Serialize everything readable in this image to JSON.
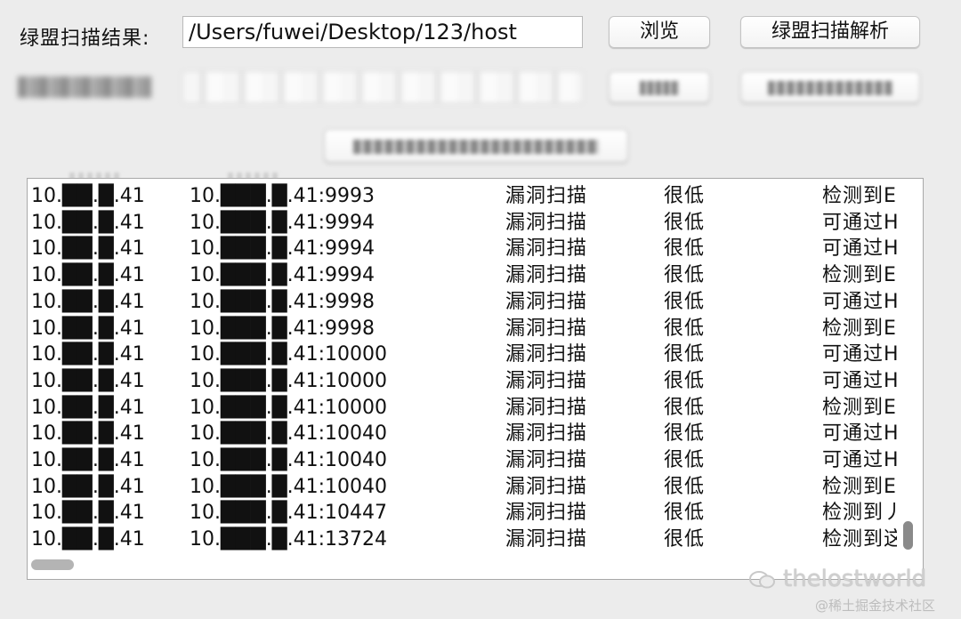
{
  "form": {
    "result_label": "绿盟扫描结果:",
    "path_value": "/Users/fuwei/Desktop/123/host",
    "browse_label": "浏览",
    "parse_label": "绿盟扫描解析"
  },
  "table": {
    "rows": [
      {
        "src": "10.██.█.41",
        "dst": "10.███.█.41:9993",
        "type": "漏洞扫描",
        "level": "很低",
        "desc": "检测到E"
      },
      {
        "src": "10.██.█.41",
        "dst": "10.███.█.41:9994",
        "type": "漏洞扫描",
        "level": "很低",
        "desc": "可通过H"
      },
      {
        "src": "10.██.█.41",
        "dst": "10.███.█.41:9994",
        "type": "漏洞扫描",
        "level": "很低",
        "desc": "可通过H"
      },
      {
        "src": "10.██.█.41",
        "dst": "10.███.█.41:9994",
        "type": "漏洞扫描",
        "level": "很低",
        "desc": "检测到E"
      },
      {
        "src": "10.██.█.41",
        "dst": "10.███.█.41:9998",
        "type": "漏洞扫描",
        "level": "很低",
        "desc": "可通过H"
      },
      {
        "src": "10.██.█.41",
        "dst": "10.███.█.41:9998",
        "type": "漏洞扫描",
        "level": "很低",
        "desc": "检测到E"
      },
      {
        "src": "10.██.█.41",
        "dst": "10.███.█.41:10000",
        "type": "漏洞扫描",
        "level": "很低",
        "desc": "可通过H"
      },
      {
        "src": "10.██.█.41",
        "dst": "10.███.█.41:10000",
        "type": "漏洞扫描",
        "level": "很低",
        "desc": "可通过H"
      },
      {
        "src": "10.██.█.41",
        "dst": "10.███.█.41:10000",
        "type": "漏洞扫描",
        "level": "很低",
        "desc": "检测到E"
      },
      {
        "src": "10.██.█.41",
        "dst": "10.███.█.41:10040",
        "type": "漏洞扫描",
        "level": "很低",
        "desc": "可通过H"
      },
      {
        "src": "10.██.█.41",
        "dst": "10.███.█.41:10040",
        "type": "漏洞扫描",
        "level": "很低",
        "desc": "可通过H"
      },
      {
        "src": "10.██.█.41",
        "dst": "10.███.█.41:10040",
        "type": "漏洞扫描",
        "level": "很低",
        "desc": "检测到E"
      },
      {
        "src": "10.██.█.41",
        "dst": "10.███.█.41:10447",
        "type": "漏洞扫描",
        "level": "很低",
        "desc": "检测到丿"
      },
      {
        "src": "10.██.█.41",
        "dst": "10.███.█.41:13724",
        "type": "漏洞扫描",
        "level": "很低",
        "desc": "检测到这"
      }
    ]
  },
  "watermark": {
    "text": "thelostworld",
    "credit": "@稀土掘金技术社区"
  }
}
